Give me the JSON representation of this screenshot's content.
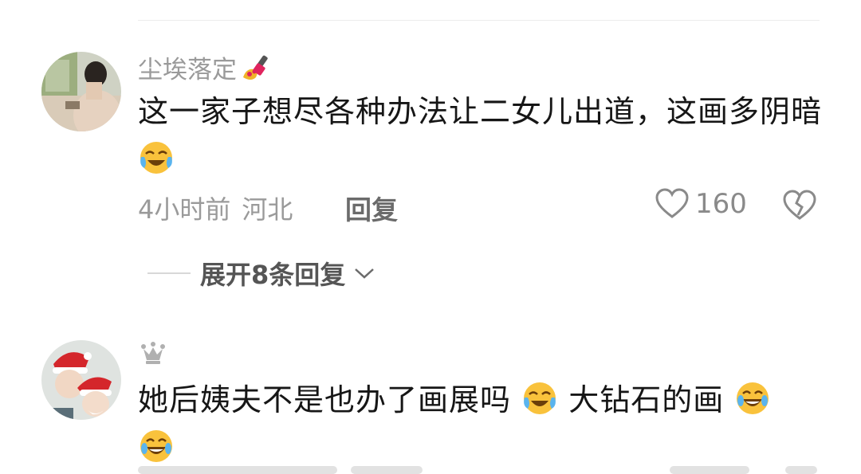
{
  "comments": [
    {
      "username": "尘埃落定",
      "username_badge_icon": "nail-polish-emoji",
      "text": "这一家子想尽各种办法让二女儿出道，这画多阴暗",
      "text_trailing_emoji": "crying-laughing-face",
      "time": "4小时前",
      "location": "河北",
      "reply_label": "回复",
      "like_count": "160",
      "expand_label": "展开8条回复"
    },
    {
      "username": "",
      "username_badge_icon": "crown-icon",
      "text_part1": "她后姨夫不是也办了画展吗",
      "text_part2": "大钻石的画",
      "emoji_1": "crying-laughing-face",
      "emoji_2": "tears-of-joy-face",
      "emoji_3": "tears-of-joy-face"
    }
  ],
  "colors": {
    "primary_text": "#161616",
    "secondary_text": "#9a9a9a",
    "reply_text": "#6b6b6b"
  }
}
